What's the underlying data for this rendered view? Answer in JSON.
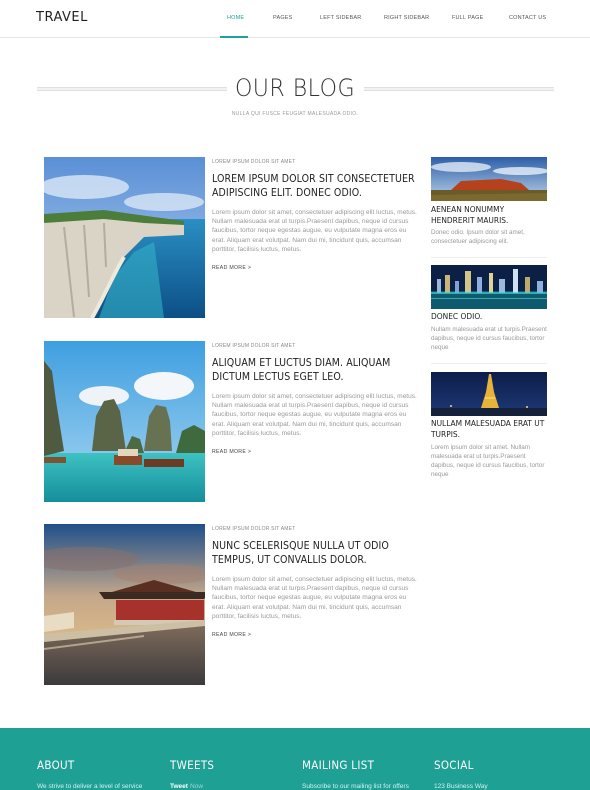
{
  "header": {
    "logo": "TRAVEL",
    "nav": [
      {
        "label": "HOME",
        "active": true
      },
      {
        "label": "PAGES"
      },
      {
        "label": "LEFT SIDEBAR"
      },
      {
        "label": "RIGHT SIDEBAR"
      },
      {
        "label": "FULL PAGE"
      },
      {
        "label": "CONTACT US"
      }
    ]
  },
  "blog": {
    "title": "OUR BLOG",
    "subtitle": "NULLA QUI FUSCE FEUGIAT MALESUADA ODIO."
  },
  "posts": [
    {
      "meta": "LOREM IPSUM DOLOR SIT AMET",
      "title": "LOREM IPSUM DOLOR SIT CONSECTETUER ADIPISCING ELIT. DONEC ODIO.",
      "body": "Lorem ipsum dolor sit amet, consectetuer adipiscing elit luctus, metus. Nullam malesuada erat ut turpis.Praesent dapibus, neque id cursus faucibus, tortor neque egestas augue, eu vulputate magna eros eu erat. Aliquam erat volutpat. Nam dui mi, tincidunt quis, accumsan porttitor, facilisis luctus, metus.",
      "more": "READ MORE >",
      "image": "white-chalk-cliffs-and-blue-sea"
    },
    {
      "meta": "LOREM IPSUM DOLOR SIT AMET",
      "title": "ALIQUAM ET LUCTUS DIAM. ALIQUAM DICTUM LECTUS EGET LEO.",
      "body": "Lorem ipsum dolor sit amet, consectetuer adipiscing elit luctus, metus. Nullam malesuada erat ut turpis.Praesent dapibus, neque id cursus faucibus, tortor neque egestas augue, eu vulputate magna eros eu erat. Aliquam erat volutpat. Nam dui mi, tincidunt quis, accumsan porttitor, facilisis luctus, metus.",
      "more": "READ MORE >",
      "image": "limestone-karsts-bay-with-boats"
    },
    {
      "meta": "LOREM IPSUM DOLOR SIT AMET",
      "title": "NUNC SCELERISQUE NULLA UT ODIO TEMPUS, UT CONVALLIS DOLOR.",
      "body": "Lorem ipsum dolor sit amet, consectetuer adipiscing elit luctus, metus. Nullam malesuada erat ut turpis.Praesent dapibus, neque id cursus faucibus, tortor neque egestas augue, eu vulputate magna eros eu erat. Aliquam erat volutpat. Nam dui mi, tincidunt quis, accumsan porttitor, facilisis luctus, metus.",
      "more": "READ MORE >",
      "image": "chinese-palace-by-moat-at-sunset"
    }
  ],
  "sidebar": [
    {
      "title": "AENEAN NONUMMY HENDRERIT MAURIS.",
      "body": "Donec odio. Ipsum dolor sit amet, consectetuer adipiscing elit.",
      "image": "red-rock-desert-monolith"
    },
    {
      "title": "DONEC ODIO.",
      "body": "Nullam malesuada erat ut turpis.Praesent dapibus, neque id cursus faucibus, tortor neque",
      "image": "city-skyline-at-night-reflection"
    },
    {
      "title": "NULLAM MALESUADA ERAT UT TURPIS.",
      "body": "Lorem ipsum dolor sit amet. Nullam malesuada erat ut turpis.Praesent dapibus, neque id cursus faucibus, tortor neque",
      "image": "eiffel-tower-at-night"
    }
  ],
  "footer": {
    "about": {
      "title": "ABOUT",
      "text": "We strive to deliver a level of service"
    },
    "tweets": {
      "title": "TWEETS",
      "handle": "Tweet",
      "time": "Now"
    },
    "mailing": {
      "title": "MAILING LIST",
      "text": "Subscribe to our mailing list for offers"
    },
    "social": {
      "title": "SOCIAL",
      "text": "123 Business Way"
    }
  },
  "colors": {
    "accent": "#1aa39a",
    "footer": "#1ea095"
  }
}
